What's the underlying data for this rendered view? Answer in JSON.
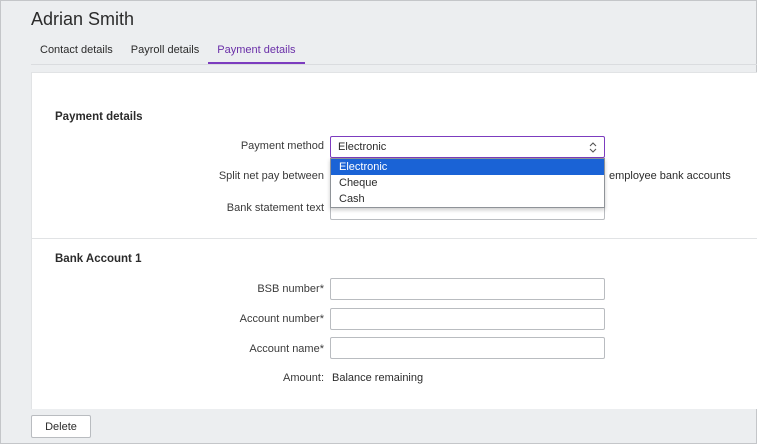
{
  "employee": {
    "name": "Adrian Smith"
  },
  "tabs": [
    {
      "label": "Contact details",
      "active": false
    },
    {
      "label": "Payroll details",
      "active": false
    },
    {
      "label": "Payment details",
      "active": true
    }
  ],
  "payment_details": {
    "section_title": "Payment details",
    "payment_method": {
      "label": "Payment method",
      "value": "Electronic",
      "options": [
        "Electronic",
        "Cheque",
        "Cash"
      ],
      "highlighted": "Electronic"
    },
    "split_net_pay": {
      "label": "Split net pay between",
      "trailing_text": "employee bank accounts"
    },
    "bank_statement_text": {
      "label": "Bank statement text",
      "value": ""
    }
  },
  "bank_account_1": {
    "section_title": "Bank Account 1",
    "bsb_number": {
      "label": "BSB number",
      "required": "*",
      "value": ""
    },
    "account_number": {
      "label": "Account number",
      "required": "*",
      "value": ""
    },
    "account_name": {
      "label": "Account name",
      "required": "*",
      "value": ""
    },
    "amount": {
      "label": "Amount:",
      "value": "Balance remaining"
    }
  },
  "footer": {
    "delete_label": "Delete"
  },
  "colors": {
    "accent": "#7c3cbf",
    "selection": "#1a63d6"
  }
}
